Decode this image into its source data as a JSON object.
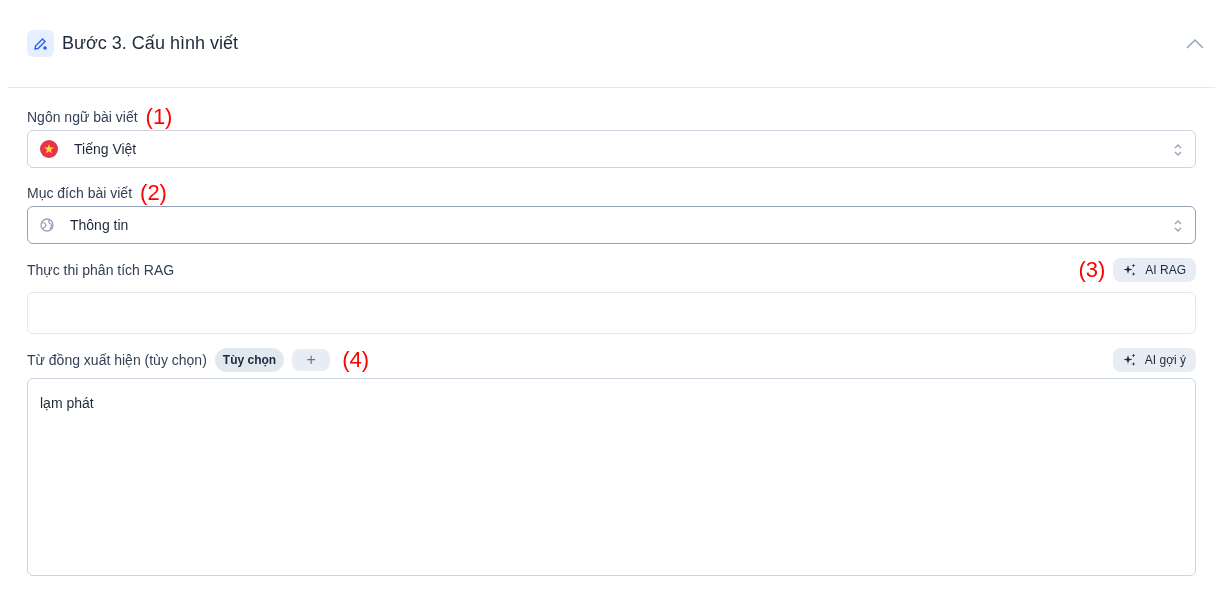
{
  "section": {
    "title": "Bước 3. Cấu hình viết",
    "expanded": true
  },
  "fields": [
    {
      "kind": "select",
      "label": "Ngôn ngữ bài viết",
      "annotation": "(1)",
      "value": "Tiếng Việt",
      "focused": false
    },
    {
      "kind": "select",
      "label": "Mục đích bài viết",
      "annotation": "(2)",
      "value": "Thông tin",
      "focused": true
    },
    {
      "kind": "input",
      "label": "Thực thi phân tích RAG",
      "annotation": "(3)",
      "action": "AI RAG"
    },
    {
      "kind": "textarea",
      "label": "Từ đồng xuất hiện (tùy chọn)",
      "chip": "Tùy chọn",
      "add": "+",
      "annotation": "(4)",
      "action": "AI gợi ý",
      "value": "lạm phát"
    }
  ]
}
